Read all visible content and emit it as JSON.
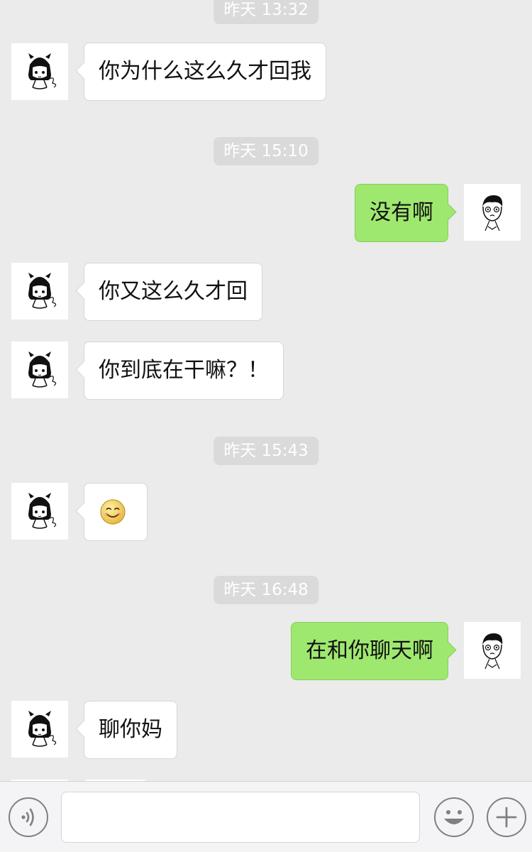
{
  "chat": {
    "timestamps": [
      "昨天 13:32",
      "昨天 15:10",
      "昨天 15:43",
      "昨天 16:48"
    ],
    "messages": [
      {
        "side": "in",
        "type": "text",
        "text": "你为什么这么久才回我"
      },
      {
        "side": "out",
        "type": "text",
        "text": "没有啊"
      },
      {
        "side": "in",
        "type": "text",
        "text": "你又这么久才回"
      },
      {
        "side": "in",
        "type": "text",
        "text": "你到底在干嘛？！"
      },
      {
        "side": "in",
        "type": "emoji",
        "icon": "smile-emoji-icon"
      },
      {
        "side": "out",
        "type": "text",
        "text": "在和你聊天啊"
      },
      {
        "side": "in",
        "type": "text",
        "text": "聊你妈"
      }
    ]
  },
  "input_bar": {
    "voice_icon": "voice-icon",
    "input_value": "",
    "emoji_icon": "emoji-face-icon",
    "plus_icon": "plus-icon"
  },
  "colors": {
    "background": "#ebebeb",
    "incoming_bubble": "#ffffff",
    "outgoing_bubble": "#9fe870",
    "timestamp_bg": "#dadada",
    "input_bar_bg": "#f4f4f6"
  }
}
